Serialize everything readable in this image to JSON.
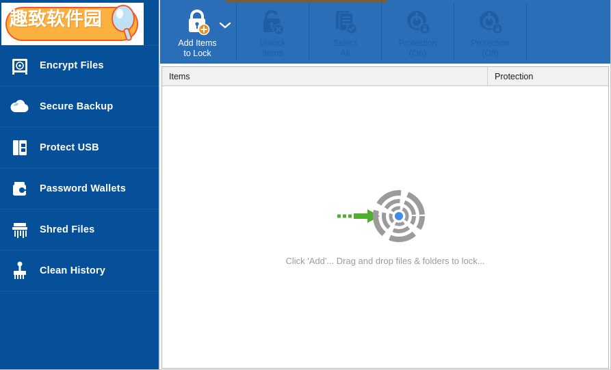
{
  "app": {
    "title": "Encrypt Files"
  },
  "logo": {
    "text": "趣致软件园",
    "badge_color": "#fcb040",
    "outline_color": "#f05a28",
    "glass_color": "#bfe0f5"
  },
  "sidebar": {
    "background": "#06509a",
    "items": [
      {
        "label": "Encrypt Files",
        "icon": "safe-icon",
        "selected": true
      },
      {
        "label": "Secure Backup",
        "icon": "cloud-icon",
        "selected": false
      },
      {
        "label": "Protect USB",
        "icon": "usb-drive-icon",
        "selected": false
      },
      {
        "label": "Password Wallets",
        "icon": "wallet-icon",
        "selected": false
      },
      {
        "label": "Shred Files",
        "icon": "shredder-icon",
        "selected": false
      },
      {
        "label": "Clean History",
        "icon": "brush-icon",
        "selected": false
      }
    ]
  },
  "toolbar": {
    "background": "#2a6eb8",
    "accent_color": "#e8901f",
    "buttons": [
      {
        "label": "Add Items\nto Lock",
        "icon": "lock-add-icon",
        "enabled": true,
        "has_dropdown": true
      },
      {
        "label": "Unlock\nItems",
        "icon": "unlock-icon",
        "enabled": false,
        "has_dropdown": false
      },
      {
        "label": "Select\nAll",
        "icon": "select-all-icon",
        "enabled": false,
        "has_dropdown": false
      },
      {
        "label": "Protection\n(On)",
        "icon": "power-on-icon",
        "enabled": false,
        "has_dropdown": false
      },
      {
        "label": "Protection\n(Off)",
        "icon": "power-off-icon",
        "enabled": false,
        "has_dropdown": false
      }
    ]
  },
  "main": {
    "columns": [
      {
        "label": "Items"
      },
      {
        "label": "Protection"
      }
    ],
    "rows": [],
    "empty_hint": "Click 'Add'... Drag and drop files & folders to lock...",
    "dropzone_icon": "target-drop-icon",
    "dropzone_arrow_color": "#4caf2e",
    "dropzone_ring_color": "#9b9b9b",
    "dropzone_center_color": "#3d8ee8"
  }
}
